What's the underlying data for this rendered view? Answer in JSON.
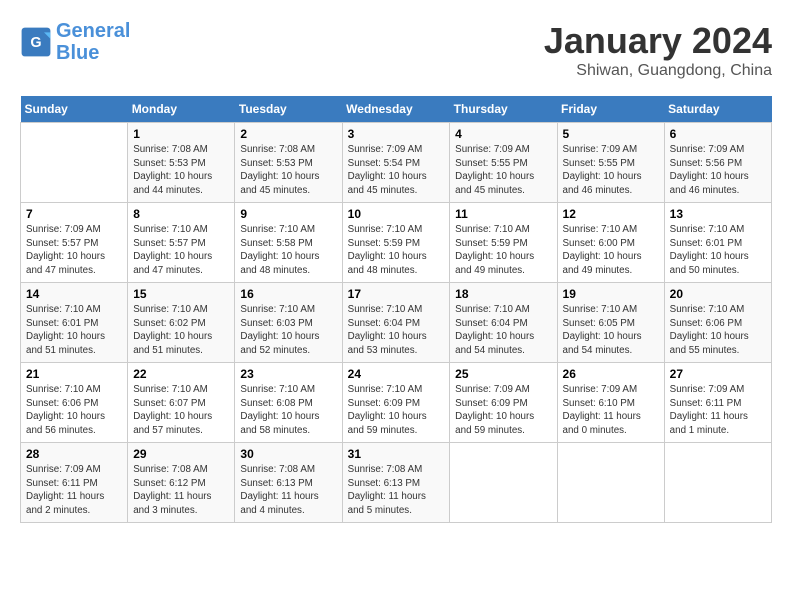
{
  "header": {
    "logo_line1": "General",
    "logo_line2": "Blue",
    "month": "January 2024",
    "location": "Shiwan, Guangdong, China"
  },
  "weekdays": [
    "Sunday",
    "Monday",
    "Tuesday",
    "Wednesday",
    "Thursday",
    "Friday",
    "Saturday"
  ],
  "weeks": [
    [
      {
        "day": "",
        "sunrise": "",
        "sunset": "",
        "daylight": ""
      },
      {
        "day": "1",
        "sunrise": "Sunrise: 7:08 AM",
        "sunset": "Sunset: 5:53 PM",
        "daylight": "Daylight: 10 hours and 44 minutes."
      },
      {
        "day": "2",
        "sunrise": "Sunrise: 7:08 AM",
        "sunset": "Sunset: 5:53 PM",
        "daylight": "Daylight: 10 hours and 45 minutes."
      },
      {
        "day": "3",
        "sunrise": "Sunrise: 7:09 AM",
        "sunset": "Sunset: 5:54 PM",
        "daylight": "Daylight: 10 hours and 45 minutes."
      },
      {
        "day": "4",
        "sunrise": "Sunrise: 7:09 AM",
        "sunset": "Sunset: 5:55 PM",
        "daylight": "Daylight: 10 hours and 45 minutes."
      },
      {
        "day": "5",
        "sunrise": "Sunrise: 7:09 AM",
        "sunset": "Sunset: 5:55 PM",
        "daylight": "Daylight: 10 hours and 46 minutes."
      },
      {
        "day": "6",
        "sunrise": "Sunrise: 7:09 AM",
        "sunset": "Sunset: 5:56 PM",
        "daylight": "Daylight: 10 hours and 46 minutes."
      }
    ],
    [
      {
        "day": "7",
        "sunrise": "Sunrise: 7:09 AM",
        "sunset": "Sunset: 5:57 PM",
        "daylight": "Daylight: 10 hours and 47 minutes."
      },
      {
        "day": "8",
        "sunrise": "Sunrise: 7:10 AM",
        "sunset": "Sunset: 5:57 PM",
        "daylight": "Daylight: 10 hours and 47 minutes."
      },
      {
        "day": "9",
        "sunrise": "Sunrise: 7:10 AM",
        "sunset": "Sunset: 5:58 PM",
        "daylight": "Daylight: 10 hours and 48 minutes."
      },
      {
        "day": "10",
        "sunrise": "Sunrise: 7:10 AM",
        "sunset": "Sunset: 5:59 PM",
        "daylight": "Daylight: 10 hours and 48 minutes."
      },
      {
        "day": "11",
        "sunrise": "Sunrise: 7:10 AM",
        "sunset": "Sunset: 5:59 PM",
        "daylight": "Daylight: 10 hours and 49 minutes."
      },
      {
        "day": "12",
        "sunrise": "Sunrise: 7:10 AM",
        "sunset": "Sunset: 6:00 PM",
        "daylight": "Daylight: 10 hours and 49 minutes."
      },
      {
        "day": "13",
        "sunrise": "Sunrise: 7:10 AM",
        "sunset": "Sunset: 6:01 PM",
        "daylight": "Daylight: 10 hours and 50 minutes."
      }
    ],
    [
      {
        "day": "14",
        "sunrise": "Sunrise: 7:10 AM",
        "sunset": "Sunset: 6:01 PM",
        "daylight": "Daylight: 10 hours and 51 minutes."
      },
      {
        "day": "15",
        "sunrise": "Sunrise: 7:10 AM",
        "sunset": "Sunset: 6:02 PM",
        "daylight": "Daylight: 10 hours and 51 minutes."
      },
      {
        "day": "16",
        "sunrise": "Sunrise: 7:10 AM",
        "sunset": "Sunset: 6:03 PM",
        "daylight": "Daylight: 10 hours and 52 minutes."
      },
      {
        "day": "17",
        "sunrise": "Sunrise: 7:10 AM",
        "sunset": "Sunset: 6:04 PM",
        "daylight": "Daylight: 10 hours and 53 minutes."
      },
      {
        "day": "18",
        "sunrise": "Sunrise: 7:10 AM",
        "sunset": "Sunset: 6:04 PM",
        "daylight": "Daylight: 10 hours and 54 minutes."
      },
      {
        "day": "19",
        "sunrise": "Sunrise: 7:10 AM",
        "sunset": "Sunset: 6:05 PM",
        "daylight": "Daylight: 10 hours and 54 minutes."
      },
      {
        "day": "20",
        "sunrise": "Sunrise: 7:10 AM",
        "sunset": "Sunset: 6:06 PM",
        "daylight": "Daylight: 10 hours and 55 minutes."
      }
    ],
    [
      {
        "day": "21",
        "sunrise": "Sunrise: 7:10 AM",
        "sunset": "Sunset: 6:06 PM",
        "daylight": "Daylight: 10 hours and 56 minutes."
      },
      {
        "day": "22",
        "sunrise": "Sunrise: 7:10 AM",
        "sunset": "Sunset: 6:07 PM",
        "daylight": "Daylight: 10 hours and 57 minutes."
      },
      {
        "day": "23",
        "sunrise": "Sunrise: 7:10 AM",
        "sunset": "Sunset: 6:08 PM",
        "daylight": "Daylight: 10 hours and 58 minutes."
      },
      {
        "day": "24",
        "sunrise": "Sunrise: 7:10 AM",
        "sunset": "Sunset: 6:09 PM",
        "daylight": "Daylight: 10 hours and 59 minutes."
      },
      {
        "day": "25",
        "sunrise": "Sunrise: 7:09 AM",
        "sunset": "Sunset: 6:09 PM",
        "daylight": "Daylight: 10 hours and 59 minutes."
      },
      {
        "day": "26",
        "sunrise": "Sunrise: 7:09 AM",
        "sunset": "Sunset: 6:10 PM",
        "daylight": "Daylight: 11 hours and 0 minutes."
      },
      {
        "day": "27",
        "sunrise": "Sunrise: 7:09 AM",
        "sunset": "Sunset: 6:11 PM",
        "daylight": "Daylight: 11 hours and 1 minute."
      }
    ],
    [
      {
        "day": "28",
        "sunrise": "Sunrise: 7:09 AM",
        "sunset": "Sunset: 6:11 PM",
        "daylight": "Daylight: 11 hours and 2 minutes."
      },
      {
        "day": "29",
        "sunrise": "Sunrise: 7:08 AM",
        "sunset": "Sunset: 6:12 PM",
        "daylight": "Daylight: 11 hours and 3 minutes."
      },
      {
        "day": "30",
        "sunrise": "Sunrise: 7:08 AM",
        "sunset": "Sunset: 6:13 PM",
        "daylight": "Daylight: 11 hours and 4 minutes."
      },
      {
        "day": "31",
        "sunrise": "Sunrise: 7:08 AM",
        "sunset": "Sunset: 6:13 PM",
        "daylight": "Daylight: 11 hours and 5 minutes."
      },
      {
        "day": "",
        "sunrise": "",
        "sunset": "",
        "daylight": ""
      },
      {
        "day": "",
        "sunrise": "",
        "sunset": "",
        "daylight": ""
      },
      {
        "day": "",
        "sunrise": "",
        "sunset": "",
        "daylight": ""
      }
    ]
  ]
}
